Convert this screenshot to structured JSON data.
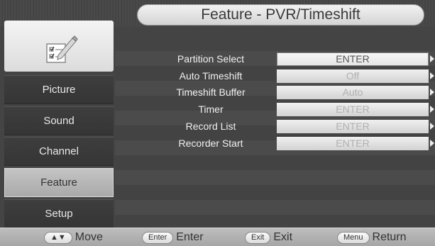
{
  "title": "Feature  -  PVR/Timeshift",
  "sidebar": {
    "items": [
      {
        "label": "Picture",
        "active": false
      },
      {
        "label": "Sound",
        "active": false
      },
      {
        "label": "Channel",
        "active": false
      },
      {
        "label": "Feature",
        "active": true
      },
      {
        "label": "Setup",
        "active": false
      }
    ]
  },
  "menu": {
    "rows": [
      {
        "label": "Partition  Select",
        "value": "ENTER",
        "selected": true
      },
      {
        "label": "Auto  Timeshift",
        "value": "Off",
        "selected": false
      },
      {
        "label": "Timeshift  Buffer",
        "value": "Auto",
        "selected": false
      },
      {
        "label": "Timer",
        "value": "ENTER",
        "selected": false
      },
      {
        "label": "Record  List",
        "value": "ENTER",
        "selected": false
      },
      {
        "label": "Recorder  Start",
        "value": "ENTER",
        "selected": false
      }
    ]
  },
  "footer": {
    "hints": [
      {
        "key": "▲▼",
        "label": "Move"
      },
      {
        "key": "Enter",
        "label": "Enter"
      },
      {
        "key": "Exit",
        "label": "Exit"
      },
      {
        "key": "Menu",
        "label": "Return"
      }
    ]
  },
  "colors": {
    "background": "#444444",
    "active_tab": "#b8b8b8",
    "value_box": "#e6e6e6"
  }
}
